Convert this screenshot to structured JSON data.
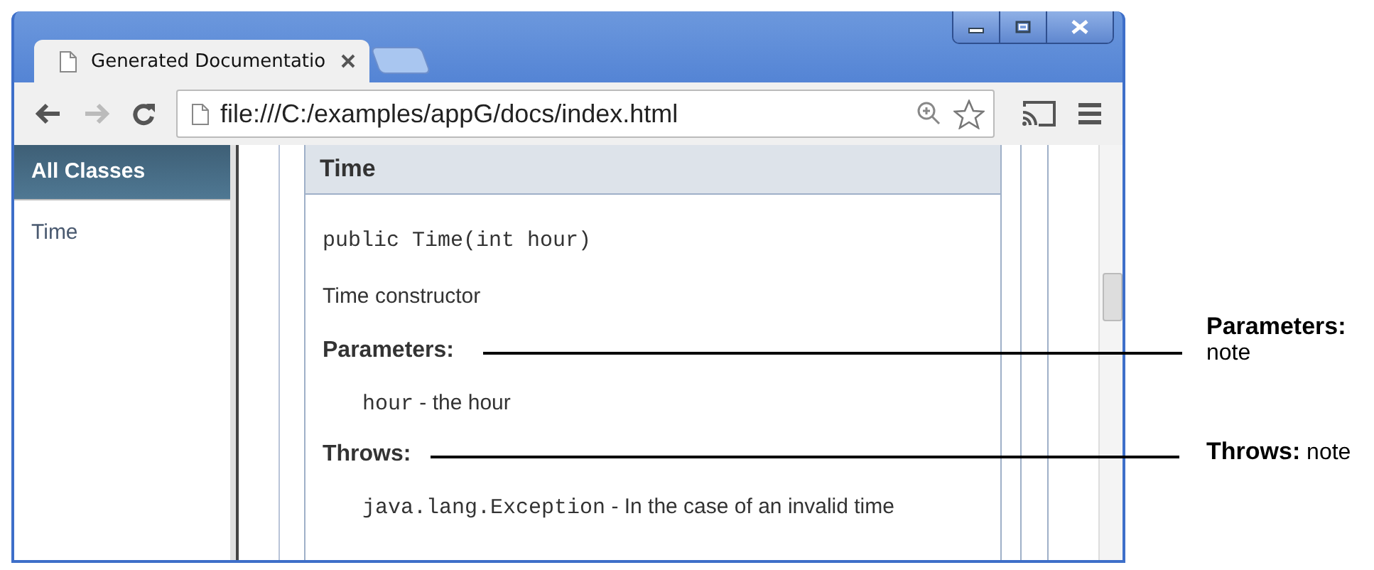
{
  "window": {
    "tab": {
      "title": "Generated Documentatio",
      "selected": true
    }
  },
  "address_bar": {
    "url": "file:///C:/examples/appG/docs/index.html"
  },
  "sidebar": {
    "heading": "All Classes",
    "items": [
      "Time"
    ]
  },
  "content": {
    "title": "Time",
    "signature": "public Time(int hour)",
    "description": "Time constructor",
    "sections": [
      {
        "heading": "Parameters:",
        "entries": [
          {
            "code": "hour",
            "text": " - the hour"
          }
        ]
      },
      {
        "heading": "Throws:",
        "entries": [
          {
            "code": "java.lang.Exception",
            "text": " - In the case of an invalid time"
          }
        ]
      }
    ]
  },
  "annotations": [
    {
      "label": "Parameters:",
      "note": "note"
    },
    {
      "label": "Throws:",
      "note": "note"
    }
  ]
}
